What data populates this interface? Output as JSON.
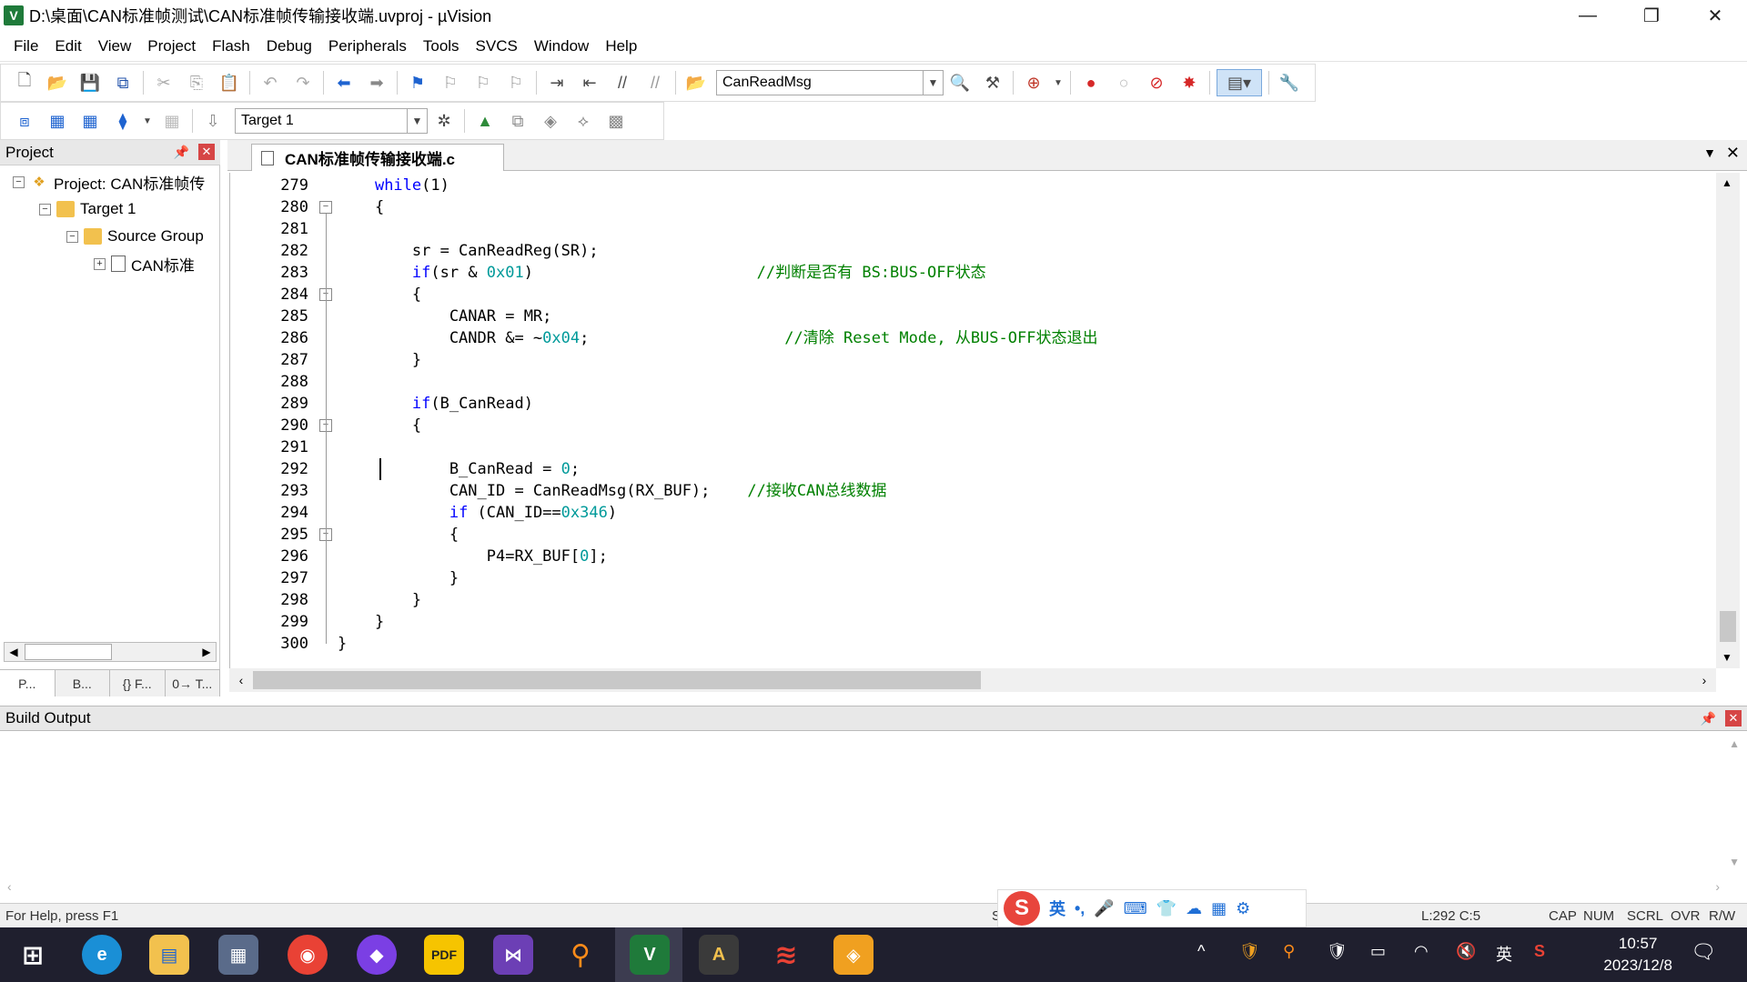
{
  "window": {
    "title": "D:\\桌面\\CAN标准帧测试\\CAN标准帧传输接收端.uvproj - µVision",
    "app_icon_text": "V",
    "controls": [
      "—",
      "❐",
      "✕"
    ]
  },
  "menu": [
    "File",
    "Edit",
    "View",
    "Project",
    "Flash",
    "Debug",
    "Peripherals",
    "Tools",
    "SVCS",
    "Window",
    "Help"
  ],
  "toolbar1": {
    "icons": [
      "new-file-icon",
      "open-icon",
      "save-icon",
      "save-all-icon",
      "cut-icon",
      "copy-icon",
      "paste-icon",
      "undo-icon",
      "redo-icon",
      "back-icon",
      "forward-icon",
      "bookmark-icon",
      "prev-bookmark-icon",
      "next-bookmark-icon",
      "clear-bookmarks-icon",
      "indent-icon",
      "unindent-icon",
      "comment-icon",
      "uncomment-icon"
    ],
    "function_combo": "CanReadMsg"
  },
  "toolbar2": {
    "target_combo": "Target 1"
  },
  "project": {
    "header": "Project",
    "tree": [
      {
        "label": "Project: CAN标准帧传",
        "level": 0,
        "exp": "−"
      },
      {
        "label": "Target 1",
        "level": 1,
        "exp": "−"
      },
      {
        "label": "Source Group",
        "level": 2,
        "exp": "−"
      },
      {
        "label": "CAN标准",
        "level": 3,
        "exp": "+"
      }
    ],
    "tabs": [
      "P...",
      "B...",
      "{} F...",
      "0→ T..."
    ]
  },
  "editor": {
    "tab": "CAN标准帧传输接收端.c",
    "lines": [
      {
        "n": "279",
        "tokens": [
          [
            "",
            "    "
          ],
          [
            "kw",
            "while"
          ],
          [
            "",
            "(1)"
          ]
        ]
      },
      {
        "n": "280",
        "fold": "−",
        "tokens": [
          [
            "",
            "    {"
          ]
        ]
      },
      {
        "n": "281",
        "tokens": []
      },
      {
        "n": "282",
        "tokens": [
          [
            "",
            "        sr = CanReadReg(SR);"
          ]
        ]
      },
      {
        "n": "283",
        "tokens": [
          [
            "",
            "        "
          ],
          [
            "kw",
            "if"
          ],
          [
            "",
            "(sr & "
          ],
          [
            "num",
            "0x01"
          ],
          [
            "",
            ")                        "
          ],
          [
            "cm",
            "//判断是否有 BS:BUS-OFF状态"
          ]
        ]
      },
      {
        "n": "284",
        "fold": "−",
        "tokens": [
          [
            "",
            "        {"
          ]
        ]
      },
      {
        "n": "285",
        "tokens": [
          [
            "",
            "            CANAR = MR;"
          ]
        ]
      },
      {
        "n": "286",
        "tokens": [
          [
            "",
            "            CANDR &= ~"
          ],
          [
            "num",
            "0x04"
          ],
          [
            "",
            ";                     "
          ],
          [
            "cm",
            "//清除 Reset Mode, 从BUS-OFF状态退出"
          ]
        ]
      },
      {
        "n": "287",
        "tokens": [
          [
            "",
            "        }"
          ]
        ]
      },
      {
        "n": "288",
        "tokens": []
      },
      {
        "n": "289",
        "tokens": [
          [
            "",
            "        "
          ],
          [
            "kw",
            "if"
          ],
          [
            "",
            "(B_CanRead)"
          ]
        ]
      },
      {
        "n": "290",
        "fold": "−",
        "tokens": [
          [
            "",
            "        {"
          ]
        ]
      },
      {
        "n": "291",
        "tokens": []
      },
      {
        "n": "292",
        "tokens": [
          [
            "",
            "            B_CanRead = "
          ],
          [
            "num",
            "0"
          ],
          [
            "",
            ";"
          ]
        ]
      },
      {
        "n": "293",
        "tokens": [
          [
            "",
            "            CAN_ID = CanReadMsg(RX_BUF);    "
          ],
          [
            "cm",
            "//接收CAN总线数据"
          ]
        ]
      },
      {
        "n": "294",
        "tokens": [
          [
            "",
            "            "
          ],
          [
            "kw",
            "if"
          ],
          [
            "",
            " (CAN_ID=="
          ],
          [
            "num",
            "0x346"
          ],
          [
            "",
            ")"
          ]
        ]
      },
      {
        "n": "295",
        "fold": "−",
        "tokens": [
          [
            "",
            "            {"
          ]
        ]
      },
      {
        "n": "296",
        "tokens": [
          [
            "",
            "                P4=RX_BUF["
          ],
          [
            "num",
            "0"
          ],
          [
            "",
            "];"
          ]
        ]
      },
      {
        "n": "297",
        "tokens": [
          [
            "",
            "            }"
          ]
        ]
      },
      {
        "n": "298",
        "tokens": [
          [
            "",
            "        }"
          ]
        ]
      },
      {
        "n": "299",
        "tokens": [
          [
            "",
            "    }"
          ]
        ]
      },
      {
        "n": "300",
        "tokens": [
          [
            "",
            "}"
          ]
        ]
      }
    ]
  },
  "build_output": {
    "header": "Build Output"
  },
  "status": {
    "help": "For Help, press F1",
    "si": "Si",
    "pos": "L:292 C:5",
    "flags": [
      "CAP",
      "NUM",
      "SCRL",
      "OVR",
      "R/W"
    ]
  },
  "ime": {
    "logo": "S",
    "items": [
      "英",
      "•,",
      "🎤",
      "⌨",
      "👕",
      "☁",
      "▦",
      "⚙"
    ]
  },
  "taskbar": {
    "apps": [
      "windows-start",
      "edge",
      "file-explorer",
      "calculator",
      "chrome",
      "paint",
      "pdf",
      "visual-studio",
      "search-tool",
      "keil-uvision",
      "autocad",
      "stc-isp",
      "security"
    ],
    "app_labels": [
      "⊞",
      "e",
      "▤",
      "▦",
      "◉",
      "◆",
      "PDF",
      "⋈",
      "⚲",
      "V",
      "A",
      "≋",
      "◈"
    ],
    "tray": [
      "^",
      "🛡",
      "⚲",
      "🛡",
      "▭",
      "◠",
      "🔇",
      "英",
      "S"
    ],
    "time": "10:57",
    "date": "2023/12/8"
  },
  "colors": {
    "keyword": "#0000ff",
    "number": "#009a9a",
    "comment": "#008000",
    "current_line": "#e8fbe8"
  }
}
